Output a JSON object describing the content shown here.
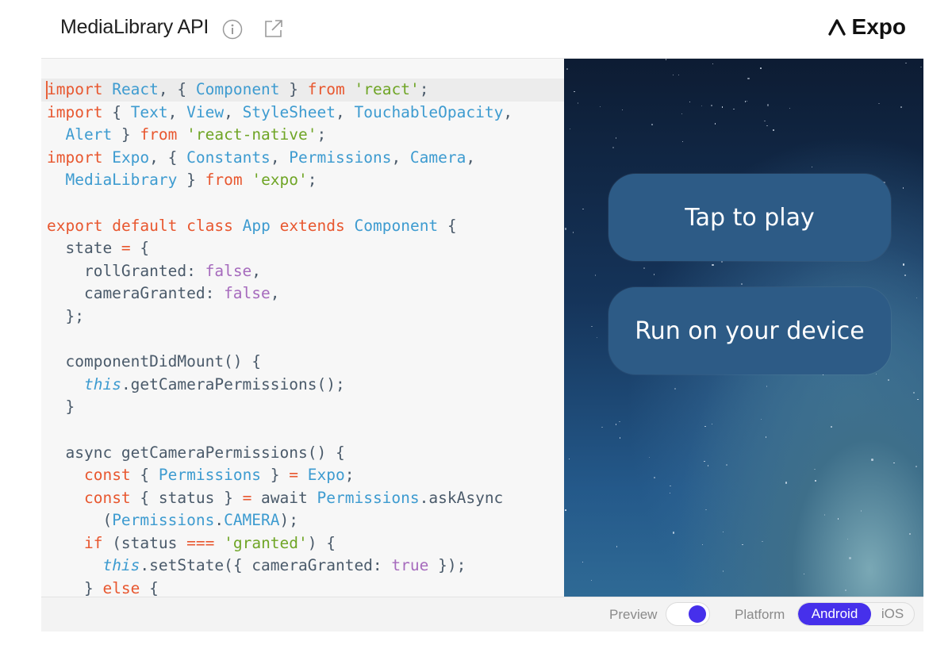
{
  "header": {
    "title": "MediaLibrary API",
    "info_icon": "info-circle-icon",
    "popout_icon": "external-link-icon",
    "brand_logo": "expo-caret-logo",
    "brand_name": "Expo"
  },
  "editor": {
    "lines": [
      [
        [
          "kw",
          "import"
        ],
        [
          "p",
          " "
        ],
        [
          "id",
          "React"
        ],
        [
          "p",
          ", { "
        ],
        [
          "id",
          "Component"
        ],
        [
          "p",
          " } "
        ],
        [
          "kw",
          "from"
        ],
        [
          "p",
          " "
        ],
        [
          "str",
          "'react'"
        ],
        [
          "p",
          ";"
        ]
      ],
      [
        [
          "kw",
          "import"
        ],
        [
          "p",
          " { "
        ],
        [
          "id",
          "Text"
        ],
        [
          "p",
          ", "
        ],
        [
          "id",
          "View"
        ],
        [
          "p",
          ", "
        ],
        [
          "id",
          "StyleSheet"
        ],
        [
          "p",
          ", "
        ],
        [
          "id",
          "TouchableOpacity"
        ],
        [
          "p",
          ","
        ]
      ],
      [
        [
          "p",
          "  "
        ],
        [
          "id",
          "Alert"
        ],
        [
          "p",
          " } "
        ],
        [
          "kw",
          "from"
        ],
        [
          "p",
          " "
        ],
        [
          "str",
          "'react-native'"
        ],
        [
          "p",
          ";"
        ]
      ],
      [
        [
          "kw",
          "import"
        ],
        [
          "p",
          " "
        ],
        [
          "id",
          "Expo"
        ],
        [
          "p",
          ", { "
        ],
        [
          "id",
          "Constants"
        ],
        [
          "p",
          ", "
        ],
        [
          "id",
          "Permissions"
        ],
        [
          "p",
          ", "
        ],
        [
          "id",
          "Camera"
        ],
        [
          "p",
          ","
        ]
      ],
      [
        [
          "p",
          "  "
        ],
        [
          "id",
          "MediaLibrary"
        ],
        [
          "p",
          " } "
        ],
        [
          "kw",
          "from"
        ],
        [
          "p",
          " "
        ],
        [
          "str",
          "'expo'"
        ],
        [
          "p",
          ";"
        ]
      ],
      [
        [
          "p",
          ""
        ]
      ],
      [
        [
          "kw",
          "export"
        ],
        [
          "p",
          " "
        ],
        [
          "kw",
          "default"
        ],
        [
          "p",
          " "
        ],
        [
          "kw",
          "class"
        ],
        [
          "p",
          " "
        ],
        [
          "id",
          "App"
        ],
        [
          "p",
          " "
        ],
        [
          "kw",
          "extends"
        ],
        [
          "p",
          " "
        ],
        [
          "id",
          "Component"
        ],
        [
          "p",
          " {"
        ]
      ],
      [
        [
          "p",
          "  state "
        ],
        [
          "op",
          "="
        ],
        [
          "p",
          " {"
        ]
      ],
      [
        [
          "p",
          "    rollGranted: "
        ],
        [
          "bool",
          "false"
        ],
        [
          "p",
          ","
        ]
      ],
      [
        [
          "p",
          "    cameraGranted: "
        ],
        [
          "bool",
          "false"
        ],
        [
          "p",
          ","
        ]
      ],
      [
        [
          "p",
          "  };"
        ]
      ],
      [
        [
          "p",
          ""
        ]
      ],
      [
        [
          "p",
          "  componentDidMount() {"
        ]
      ],
      [
        [
          "p",
          "    "
        ],
        [
          "this",
          "this"
        ],
        [
          "p",
          ".getCameraPermissions();"
        ]
      ],
      [
        [
          "p",
          "  }"
        ]
      ],
      [
        [
          "p",
          ""
        ]
      ],
      [
        [
          "p",
          "  async getCameraPermissions() {"
        ]
      ],
      [
        [
          "p",
          "    "
        ],
        [
          "kw",
          "const"
        ],
        [
          "p",
          " { "
        ],
        [
          "id",
          "Permissions"
        ],
        [
          "p",
          " } "
        ],
        [
          "op",
          "="
        ],
        [
          "p",
          " "
        ],
        [
          "id",
          "Expo"
        ],
        [
          "p",
          ";"
        ]
      ],
      [
        [
          "p",
          "    "
        ],
        [
          "kw",
          "const"
        ],
        [
          "p",
          " { status } "
        ],
        [
          "op",
          "="
        ],
        [
          "p",
          " await "
        ],
        [
          "id",
          "Permissions"
        ],
        [
          "p",
          ".askAsync"
        ]
      ],
      [
        [
          "p",
          "      ("
        ],
        [
          "id",
          "Permissions"
        ],
        [
          "p",
          "."
        ],
        [
          "id",
          "CAMERA"
        ],
        [
          "p",
          ");"
        ]
      ],
      [
        [
          "p",
          "    "
        ],
        [
          "kw",
          "if"
        ],
        [
          "p",
          " (status "
        ],
        [
          "op",
          "==="
        ],
        [
          "p",
          " "
        ],
        [
          "str",
          "'granted'"
        ],
        [
          "p",
          ") {"
        ]
      ],
      [
        [
          "p",
          "      "
        ],
        [
          "this",
          "this"
        ],
        [
          "p",
          ".setState({ cameraGranted: "
        ],
        [
          "bool",
          "true"
        ],
        [
          "p",
          " });"
        ]
      ],
      [
        [
          "p",
          "    } "
        ],
        [
          "kw",
          "else"
        ],
        [
          "p",
          " {"
        ]
      ]
    ]
  },
  "preview": {
    "play_label": "Tap to play",
    "run_label": "Run on your device"
  },
  "footer": {
    "preview_label": "Preview",
    "preview_toggle_on": true,
    "platform_label": "Platform",
    "platform_options": [
      "Android",
      "iOS"
    ],
    "platform_selected": "Android"
  },
  "colors": {
    "accent": "#4630eb",
    "keyword": "#e8572f",
    "identifier": "#3d9bd0",
    "string": "#6fa526",
    "boolean": "#a66bbd",
    "preview_button": "#2d5b86"
  }
}
